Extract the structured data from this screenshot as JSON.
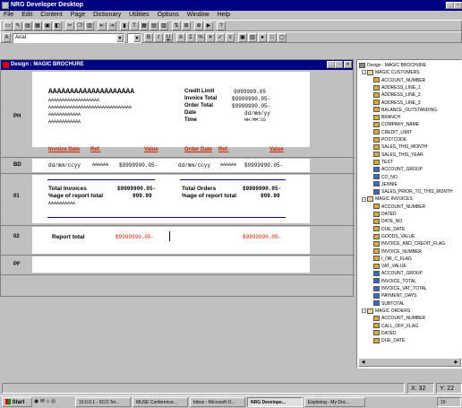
{
  "app": {
    "title": "NRG Developer Desktop",
    "win_buttons": [
      "_",
      "▫",
      "×"
    ]
  },
  "menu": [
    "File",
    "Edit",
    "Content",
    "Page",
    "Dictionary",
    "Utilities",
    "Options",
    "Window",
    "Help"
  ],
  "toolbar2": {
    "font": "Arial",
    "size": "",
    "format_buttons": [
      "B",
      "I",
      "U",
      "A",
      "Σ",
      "%",
      "✕",
      "✓",
      "≡"
    ]
  },
  "design": {
    "title": "Design : MAGIC BROCHURE",
    "bands": {
      "ph": "PH",
      "bd": "BD",
      "b01": "01",
      "b02": "02",
      "pf": "PF"
    },
    "header": {
      "name_big": "AAAAAAAAAAAAAAAAAAAA",
      "addr1": "AAAAAAAAAAAAAAAAAAA",
      "addr2": "AAAAAAAAAAAAAAAAAAAAAAAAAAAAAAA",
      "addr3": "AAAAAAAAAAAA",
      "addr4": "AAAAAAAAAAAA",
      "credit_limit_label": "Credit Limit",
      "invoice_total_label": "Invoice Total",
      "order_total_label": "Order Total",
      "date_label": "Date",
      "time_label": "Time",
      "credit_limit_val": "9999999.05",
      "invoice_total_val": "$9999990.05-",
      "order_total_val": "$9999990.05-",
      "date_val": "dd/mm/yy",
      "time_val": "HH:MM:SS",
      "col_invoice_date": "Invoice Date",
      "col_ref1": "Ref.",
      "col_value1": "Value",
      "col_order_date": "Order Date",
      "col_ref2": "Ref.",
      "col_value2": "Value"
    },
    "detail": {
      "inv_date": "dd/mm/ccyy",
      "inv_ref": "AAAAAA",
      "inv_value": "$9999990.05-",
      "ord_date": "dd/mm/ccyy",
      "ord_ref": "AAAAAA",
      "ord_value": "$9999990.05-"
    },
    "group": {
      "total_invoices_label": "Total Invoices",
      "pct_report_label1": "%age of report total",
      "total_invoices_val": "$9999990.05-",
      "pct1_val": "999.99",
      "code": "AAAAAAAAAA",
      "total_orders_label": "Total Orders",
      "pct_report_label2": "%age of report total",
      "total_orders_val": "$9999990.05-",
      "pct2_val": "999.99"
    },
    "report_total": {
      "label": "Report total",
      "val1": "$9999990.05-",
      "val2": "$9999990.05-"
    }
  },
  "tree": {
    "root": "Design : MAGIC BROCHURE",
    "groups": [
      {
        "name": "MAGIC CUSTOMERS",
        "items": [
          {
            "label": "ACCOUNT_NUMBER",
            "kind": "field"
          },
          {
            "label": "ADDRESS_LINE_1",
            "kind": "field"
          },
          {
            "label": "ADDRESS_LINE_2",
            "kind": "field"
          },
          {
            "label": "ADDRESS_LINE_3",
            "kind": "field"
          },
          {
            "label": "BALANCE_OUTSTANDING",
            "kind": "field"
          },
          {
            "label": "BRANCH",
            "kind": "field"
          },
          {
            "label": "COMPANY_NAME",
            "kind": "field"
          },
          {
            "label": "CREDIT_LIMIT",
            "kind": "field"
          },
          {
            "label": "POSTCODE",
            "kind": "field"
          },
          {
            "label": "SALES_THIS_MONTH",
            "kind": "field"
          },
          {
            "label": "SALES_THIS_YEAR",
            "kind": "field"
          },
          {
            "label": "TEST",
            "kind": "field"
          },
          {
            "label": "ACCOUNT_GROUP",
            "kind": "calc"
          },
          {
            "label": "CO_NO",
            "kind": "calc"
          },
          {
            "label": "JENNIE",
            "kind": "calc"
          },
          {
            "label": "SALES_PRIOR_TO_THIS_MONTH",
            "kind": "calc"
          }
        ]
      },
      {
        "name": "MAGIC INVOICES",
        "items": [
          {
            "label": "ACCOUNT_NUMBER",
            "kind": "field"
          },
          {
            "label": "DATED",
            "kind": "field"
          },
          {
            "label": "DATE_NO",
            "kind": "field"
          },
          {
            "label": "DUE_DATE",
            "kind": "field"
          },
          {
            "label": "GOODS_VALUE",
            "kind": "field"
          },
          {
            "label": "INVOICE_AND_CREDIT_FLAG",
            "kind": "field"
          },
          {
            "label": "INVOICE_NUMBER",
            "kind": "field"
          },
          {
            "label": "I_OR_C_FLAG",
            "kind": "field"
          },
          {
            "label": "VAT_VALUE",
            "kind": "field"
          },
          {
            "label": "ACCOUNT_GROUP",
            "kind": "calc"
          },
          {
            "label": "INVOICE_TOTAL",
            "kind": "calc"
          },
          {
            "label": "INVOICE_VAT_TOTAL",
            "kind": "calc"
          },
          {
            "label": "PAYMENT_DAYS",
            "kind": "calc"
          },
          {
            "label": "SUBTOTAL",
            "kind": "calc"
          }
        ]
      },
      {
        "name": "MAGIC ORDERS",
        "items": [
          {
            "label": "ACCOUNT_NUMBER",
            "kind": "field"
          },
          {
            "label": "CALL_OFF_FLAG",
            "kind": "field"
          },
          {
            "label": "DATED",
            "kind": "field"
          },
          {
            "label": "DUE_DATE",
            "kind": "field"
          }
        ]
      }
    ]
  },
  "status": {
    "x": "X: 32",
    "y": "Y: 22"
  },
  "taskbar": {
    "start": "Start",
    "tasks": [
      "10.0.0.1 - SCO Ter...",
      "MUSE Conference...",
      "Inbox - Microsoft O...",
      "NRG Develope...",
      "Exploring - My Doc..."
    ],
    "clock": "15:"
  },
  "colors": {
    "titlebar": "#000080",
    "accent_red": "#cc2200",
    "band_line": "#0000a0"
  }
}
